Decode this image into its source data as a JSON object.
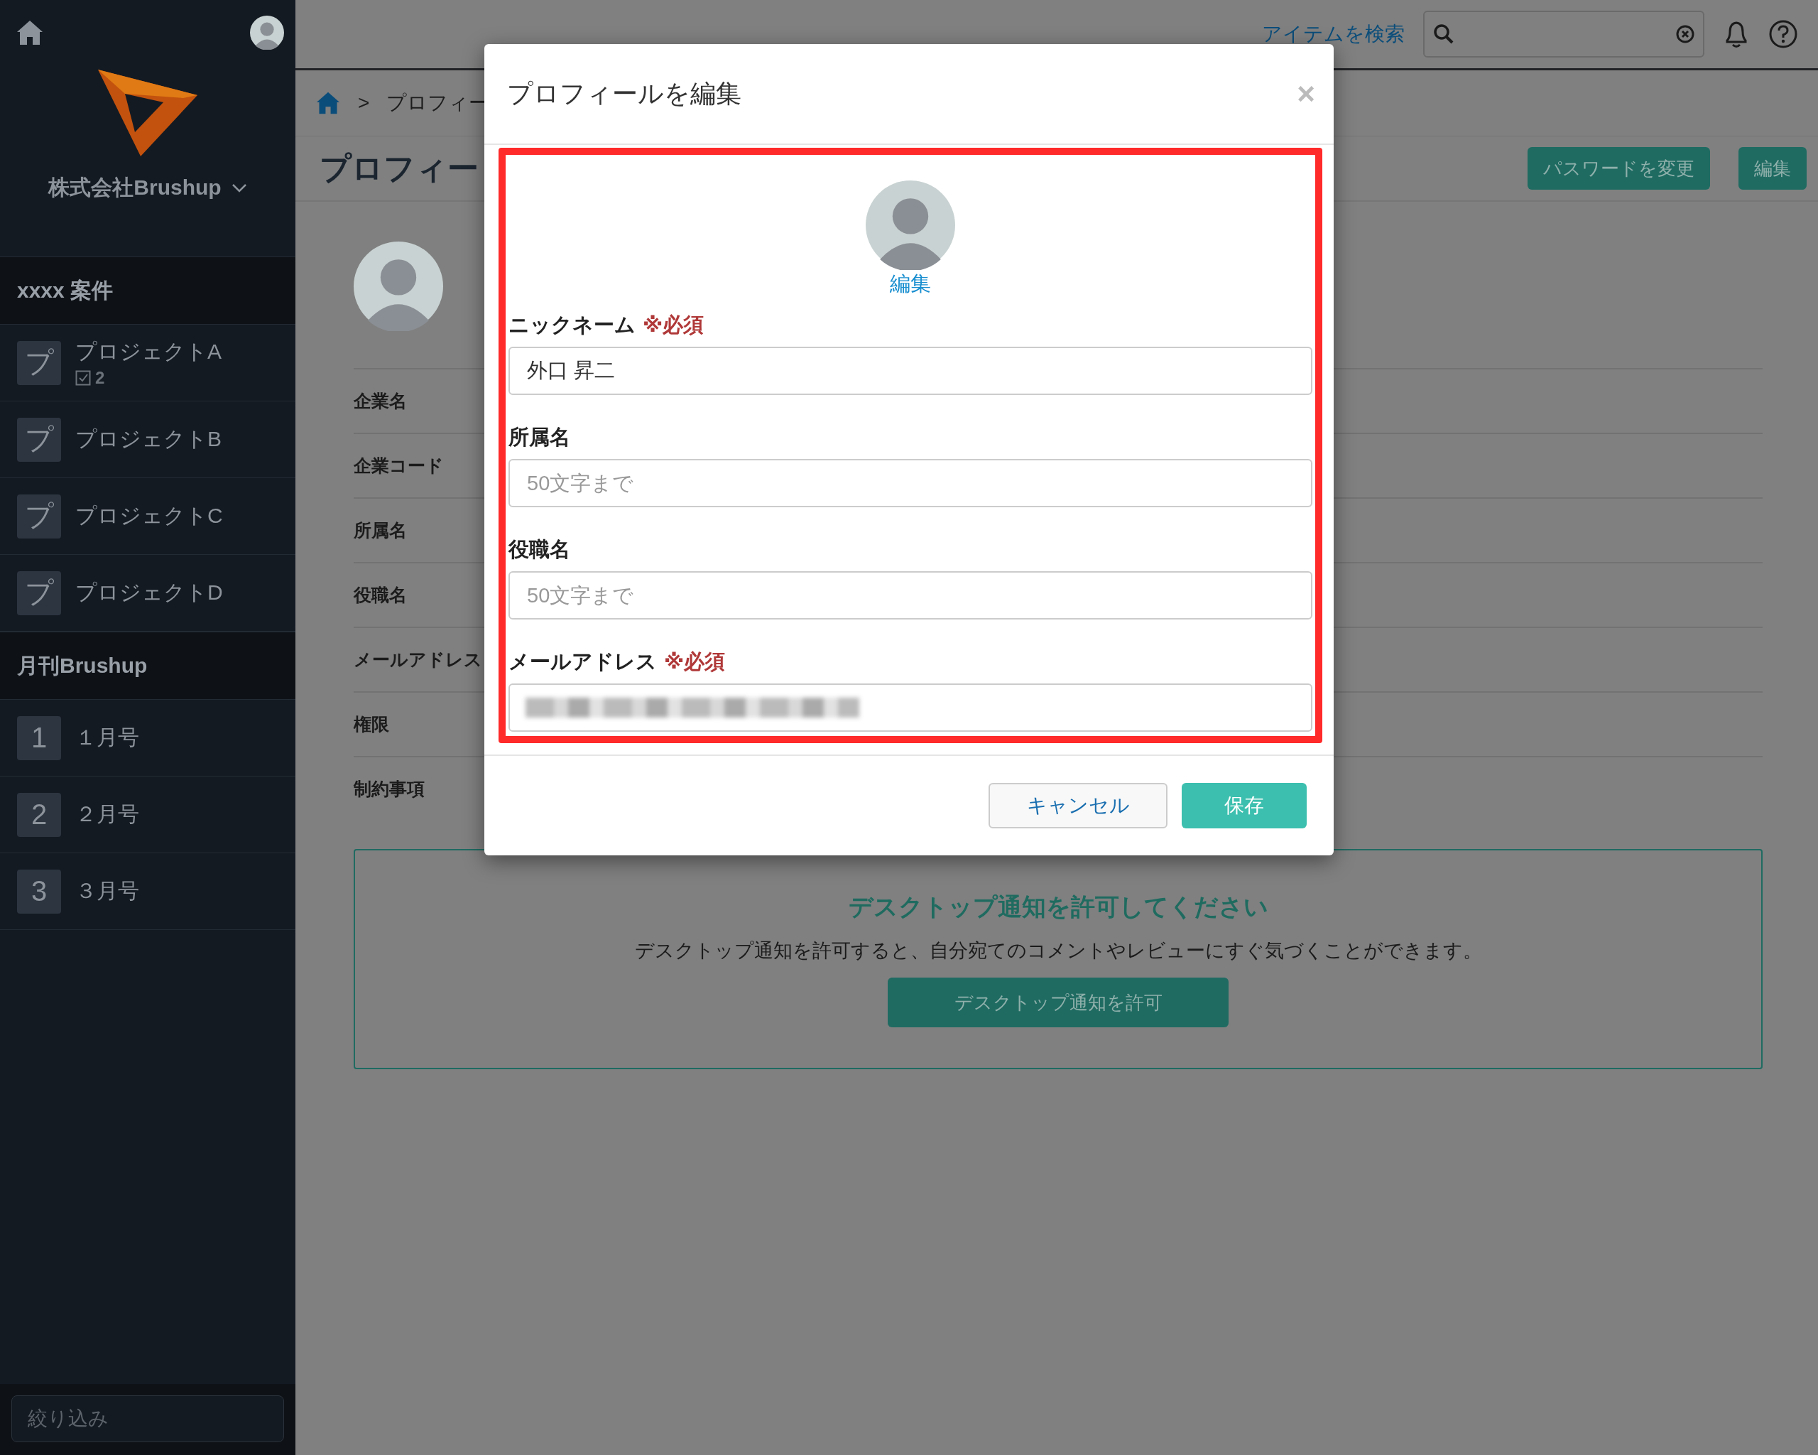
{
  "sidebar": {
    "company": "株式会社Brushup",
    "sections": [
      {
        "title": "xxxx 案件",
        "items": [
          {
            "icon": "プ",
            "label": "プロジェクトA",
            "count": "2"
          },
          {
            "icon": "プ",
            "label": "プロジェクトB"
          },
          {
            "icon": "プ",
            "label": "プロジェクトC"
          },
          {
            "icon": "プ",
            "label": "プロジェクトD"
          }
        ]
      },
      {
        "title": "月刊Brushup",
        "items": [
          {
            "icon": "1",
            "label": "１月号"
          },
          {
            "icon": "2",
            "label": "２月号"
          },
          {
            "icon": "3",
            "label": "３月号"
          }
        ]
      }
    ],
    "filter": {
      "placeholder": "絞り込み"
    }
  },
  "topbar": {
    "search_link": "アイテムを検索"
  },
  "breadcrumb": {
    "separator": ">",
    "current": "プロフィー"
  },
  "page": {
    "title": "プロフィー",
    "buttons": [
      "パスワードを変更",
      "編集"
    ],
    "fields": [
      "企業名",
      "企業コード",
      "所属名",
      "役職名",
      "メールアドレス",
      "権限",
      "制約事項"
    ],
    "notice": {
      "title": "デスクトップ通知を許可してください",
      "text": "デスクトップ通知を許可すると、自分宛てのコメントやレビューにすぐ気づくことができます。",
      "button": "デスクトップ通知を許可"
    }
  },
  "dialog": {
    "title": "プロフィールを編集",
    "close": "×",
    "avatar_link": "編集",
    "fields": [
      {
        "kind": "text",
        "label": "ニックネーム",
        "required": "※必須",
        "value": "外口 昇二"
      },
      {
        "kind": "text",
        "label": "所属名",
        "placeholder": "50文字まで"
      },
      {
        "kind": "text",
        "label": "役職名",
        "placeholder": "50文字まで"
      },
      {
        "kind": "redacted",
        "label": "メールアドレス",
        "required": "※必須"
      }
    ],
    "buttons": [
      {
        "kind": "secondary",
        "label": "キャンセル"
      },
      {
        "kind": "primary",
        "label": "保存"
      }
    ]
  }
}
